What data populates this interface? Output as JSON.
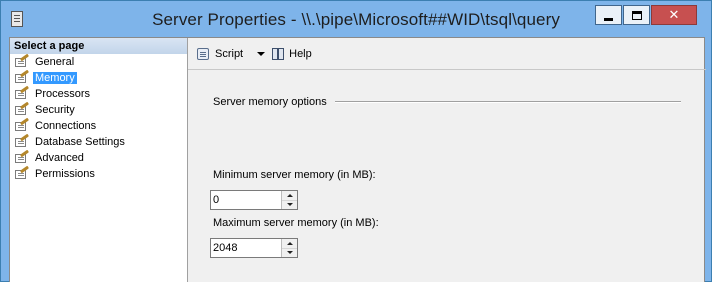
{
  "window": {
    "title": "Server Properties - \\\\.\\pipe\\Microsoft##WID\\tsql\\query",
    "icon": "database-server-icon",
    "accent_color": "#7eb4ea",
    "close_color": "#c75050",
    "close_glyph": "✕"
  },
  "sidebar": {
    "header": "Select a page",
    "selected": "Memory",
    "selection_color": "#3399ff",
    "items": [
      {
        "label": "General",
        "icon": "properties-page-icon"
      },
      {
        "label": "Memory",
        "icon": "properties-page-icon"
      },
      {
        "label": "Processors",
        "icon": "properties-page-icon"
      },
      {
        "label": "Security",
        "icon": "properties-page-icon"
      },
      {
        "label": "Connections",
        "icon": "properties-page-icon"
      },
      {
        "label": "Database Settings",
        "icon": "properties-page-icon"
      },
      {
        "label": "Advanced",
        "icon": "properties-page-icon"
      },
      {
        "label": "Permissions",
        "icon": "properties-page-icon"
      }
    ]
  },
  "toolbar": {
    "script_label": "Script",
    "script_icon": "script-icon",
    "help_label": "Help",
    "help_icon": "help-icon"
  },
  "memory": {
    "group_title": "Server memory options",
    "min_label": "Minimum server memory (in MB):",
    "min_value": "0",
    "max_label": "Maximum server memory (in MB):",
    "max_value": "2048"
  }
}
